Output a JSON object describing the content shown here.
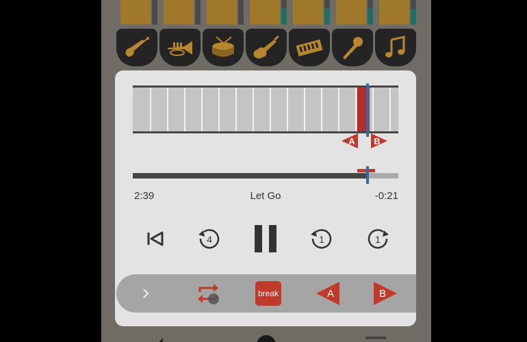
{
  "mixer": {
    "strips": [
      {
        "meter_level": 0.0
      },
      {
        "meter_level": 0.0
      },
      {
        "meter_level": 0.0
      },
      {
        "meter_level": 0.72
      },
      {
        "meter_level": 0.7
      },
      {
        "meter_level": 0.72
      },
      {
        "meter_level": 0.68
      }
    ],
    "instruments": [
      {
        "icon": "bass-guitar-icon"
      },
      {
        "icon": "trumpet-icon"
      },
      {
        "icon": "drum-icon"
      },
      {
        "icon": "electric-guitar-icon"
      },
      {
        "icon": "keyboard-icon"
      },
      {
        "icon": "microphone-icon"
      },
      {
        "icon": "music-note-icon"
      }
    ]
  },
  "player": {
    "elapsed": "2:39",
    "title": "Let Go",
    "remaining": "-0:21",
    "progress_fraction": 0.883,
    "loop_start_fraction": 0.846,
    "loop_end_fraction": 0.892,
    "marker_a_label": "A",
    "marker_b_label": "B",
    "controls": {
      "skip_back_seconds": "4",
      "rewind_seconds": "1",
      "forward_seconds": "1"
    }
  },
  "bottom_bar": {
    "break_label": "break",
    "a_label": "A",
    "b_label": "B"
  },
  "colors": {
    "accent_red": "#c0392b",
    "cursor_blue": "#2d6fa3",
    "fader_gold": "#a07829"
  }
}
